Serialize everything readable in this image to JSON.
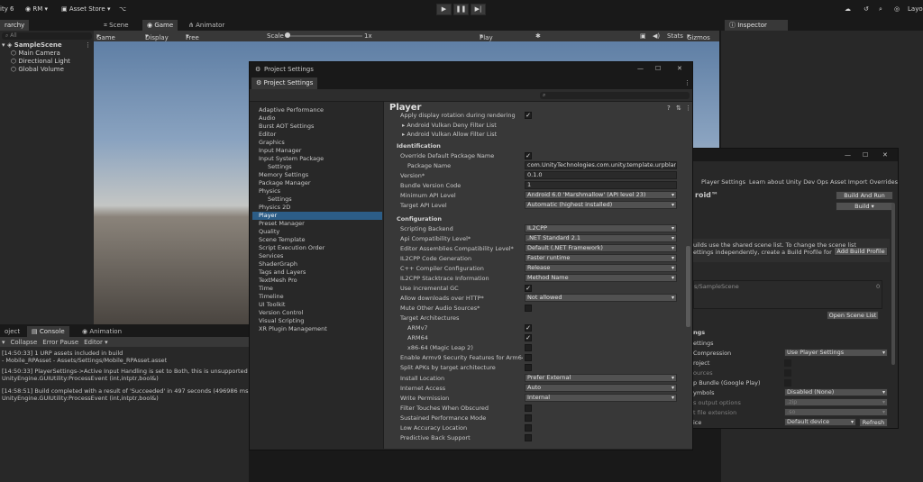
{
  "topbar": {
    "app_fragment": "ity 6",
    "account": "RM",
    "asset_store": "Asset Store",
    "layout": "Layou"
  },
  "hierarchy": {
    "tab": "rarchy",
    "search_placeholder": "All",
    "scene": "SampleScene",
    "items": [
      "Main Camera",
      "Directional Light",
      "Global Volume"
    ]
  },
  "scene_tabs": {
    "scene": "Scene",
    "game": "Game",
    "animator": "Animator"
  },
  "gamebar": {
    "mode": "Game",
    "display": "Display 1",
    "aspect": "Free Aspect",
    "scale_label": "Scale",
    "scale_value": "1x",
    "play_mode": "Play Unfocused",
    "stats": "Stats",
    "gizmos": "Gizmos"
  },
  "inspector": {
    "tab": "Inspector"
  },
  "console": {
    "tabs": [
      "oject",
      "Console",
      "Animation"
    ],
    "collapse": "Collapse",
    "error_pause": "Error Pause",
    "editor": "Editor",
    "lines": [
      "[14:50:33] 1 URP assets included in build",
      "- Mobile_RPAsset - Assets/Settings/Mobile_RPAsset.asset",
      "[14:50:33] PlayerSettings->Active Input Handling is set to Both, this is unsupported on A",
      "UnityEngine.GUIUtility:ProcessEvent (int,intptr,bool&)",
      "[14:58:51] Build completed with a result of 'Succeeded' in 497 seconds (496986 ms)",
      "UnityEngine.GUIUtility:ProcessEvent (int,intptr,bool&)"
    ]
  },
  "project_settings": {
    "window_title": "Project Settings",
    "tab": "Project Settings",
    "categories": [
      {
        "label": "Adaptive Performance",
        "indent": false
      },
      {
        "label": "Audio",
        "indent": false
      },
      {
        "label": "Burst AOT Settings",
        "indent": false
      },
      {
        "label": "Editor",
        "indent": false
      },
      {
        "label": "Graphics",
        "indent": false
      },
      {
        "label": "Input Manager",
        "indent": false
      },
      {
        "label": "Input System Package",
        "indent": false
      },
      {
        "label": "Settings",
        "indent": true
      },
      {
        "label": "Memory Settings",
        "indent": false
      },
      {
        "label": "Package Manager",
        "indent": false
      },
      {
        "label": "Physics",
        "indent": false
      },
      {
        "label": "Settings",
        "indent": true
      },
      {
        "label": "Physics 2D",
        "indent": false
      },
      {
        "label": "Player",
        "indent": false,
        "selected": true
      },
      {
        "label": "Preset Manager",
        "indent": false
      },
      {
        "label": "Quality",
        "indent": false
      },
      {
        "label": "Scene Template",
        "indent": false
      },
      {
        "label": "Script Execution Order",
        "indent": false
      },
      {
        "label": "Services",
        "indent": false
      },
      {
        "label": "ShaderGraph",
        "indent": false
      },
      {
        "label": "Tags and Layers",
        "indent": false
      },
      {
        "label": "TextMesh Pro",
        "indent": false
      },
      {
        "label": "Time",
        "indent": false
      },
      {
        "label": "Timeline",
        "indent": false
      },
      {
        "label": "UI Toolkit",
        "indent": false
      },
      {
        "label": "Version Control",
        "indent": false
      },
      {
        "label": "Visual Scripting",
        "indent": false
      },
      {
        "label": "XR Plugin Management",
        "indent": false
      }
    ],
    "player": {
      "title": "Player",
      "apply_display_rotation": "Apply display rotation during rendering",
      "vulkan_deny": "Android Vulkan Deny Filter List",
      "vulkan_allow": "Android Vulkan Allow Filter List",
      "identification_header": "Identification",
      "override_default_package": "Override Default Package Name",
      "package_name_label": "Package Name",
      "package_name_value": "com.UnityTechnologies.com.unity.template.urpblank",
      "version_label": "Version*",
      "version_value": "0.1.0",
      "bundle_version_label": "Bundle Version Code",
      "bundle_version_value": "1",
      "min_api_label": "Minimum API Level",
      "min_api_value": "Android 6.0 'Marshmallow' (API level 23)",
      "target_api_label": "Target API Level",
      "target_api_value": "Automatic (highest installed)",
      "configuration_header": "Configuration",
      "scripting_backend_label": "Scripting Backend",
      "scripting_backend_value": "IL2CPP",
      "api_compat_label": "Api Compatibility Level*",
      "api_compat_value": ".NET Standard 2.1",
      "editor_assemblies_label": "Editor Assemblies Compatibility Level*",
      "editor_assemblies_value": "Default (.NET Framework)",
      "il2cpp_codegen_label": "IL2CPP Code Generation",
      "il2cpp_codegen_value": "Faster runtime",
      "cpp_compiler_label": "C++ Compiler Configuration",
      "cpp_compiler_value": "Release",
      "il2cpp_stacktrace_label": "IL2CPP Stacktrace Information",
      "il2cpp_stacktrace_value": "Method Name",
      "incremental_gc": "Use incremental GC",
      "allow_http_label": "Allow downloads over HTTP*",
      "allow_http_value": "Not allowed",
      "mute_audio": "Mute Other Audio Sources*",
      "target_arch": "Target Architectures",
      "armv7": "ARMv7",
      "arm64": "ARM64",
      "x86_64": "x86-64 (Magic Leap 2)",
      "armv9": "Enable Armv9 Security Features for Arm64",
      "split_apks": "Split APKs by target architecture",
      "install_location_label": "Install Location",
      "install_location_value": "Prefer External",
      "internet_access_label": "Internet Access",
      "internet_access_value": "Auto",
      "write_permission_label": "Write Permission",
      "write_permission_value": "Internal",
      "filter_touches": "Filter Touches When Obscured",
      "sustained_perf": "Sustained Performance Mode",
      "low_accuracy": "Low Accuracy Location",
      "predictive_back": "Predictive Back Support"
    }
  },
  "build_window": {
    "tabs": [
      "Player Settings",
      "Learn about Unity Dev Ops",
      "Asset Import Overrides"
    ],
    "platform": "roid™",
    "build_and_run": "Build And Run",
    "build": "Build",
    "scene_list_note_1": "uilds use the shared scene list. To change the scene list",
    "scene_list_note_2": "ettings independently, create a Build Profile for this",
    "add_build_profile": "Add Build Profile",
    "scene_entry": "s/SampleScene",
    "scene_index": "0",
    "open_scene_list": "Open Scene List",
    "settings_head": "ngs",
    "settings_sub": "ettings",
    "compression_label": "Compression",
    "compression_value": "Use Player Settings",
    "project_label": "roject",
    "sources_label": "ources",
    "app_bundle_label": "p Bundle (Google Play)",
    "symbols_label": "ymbols",
    "symbols_value": "Disabled (None)",
    "output_options_label": "s output options",
    "output_options_value": ".zip",
    "ext_label": "t file extension",
    "ext_value": ".so",
    "device_label": "ice",
    "device_value": "Default device",
    "refresh": "Refresh"
  }
}
